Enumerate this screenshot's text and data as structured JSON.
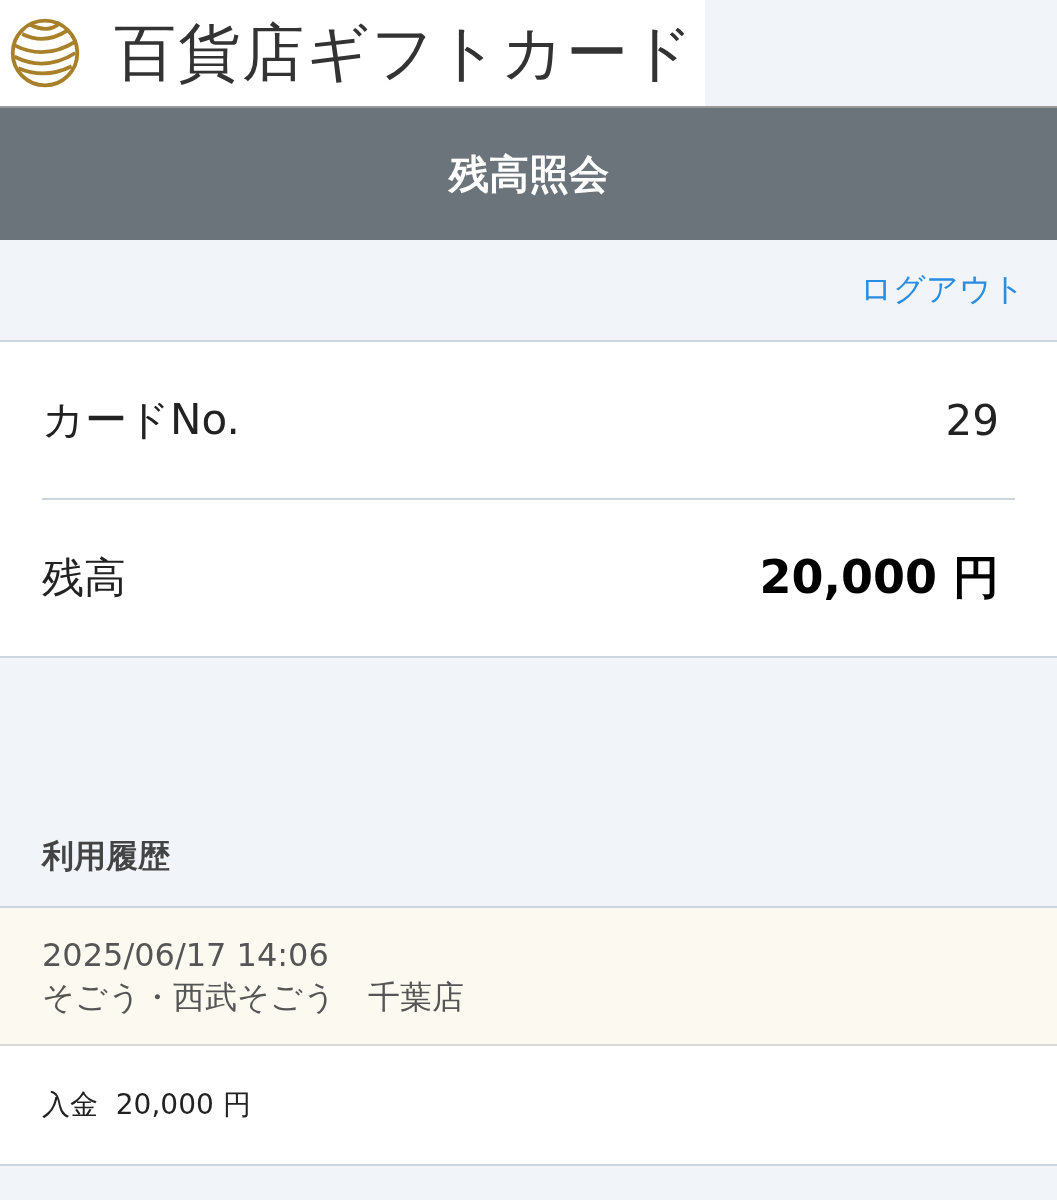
{
  "logo": {
    "title": "百貨店ギフトカード"
  },
  "header": {
    "title": "残高照会"
  },
  "logout": "ログアウト",
  "card": {
    "rows": [
      {
        "label": "カードNo.",
        "value": "29",
        "kind": "plain"
      },
      {
        "label": "残高",
        "value": "20,000 円",
        "kind": "strong"
      }
    ]
  },
  "history": {
    "title": "利用履歴",
    "entries": [
      {
        "datetime": "2025/06/17 14:06",
        "store": "そごう・西武そごう　千葉店",
        "detail": "入金  20,000 円"
      }
    ]
  }
}
